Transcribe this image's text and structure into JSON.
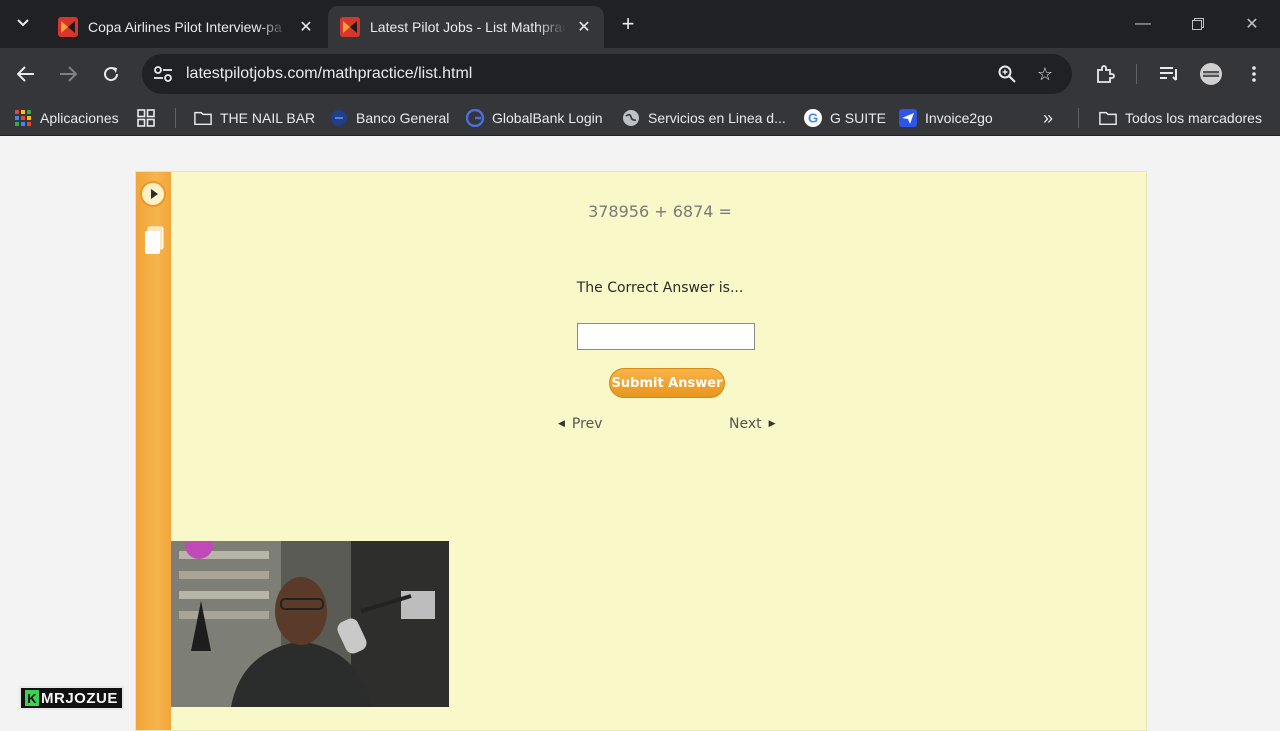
{
  "browser": {
    "tabs": [
      {
        "title": "Copa Airlines Pilot Interview-pa",
        "active": false
      },
      {
        "title": "Latest Pilot Jobs - List Mathprac",
        "active": true
      }
    ],
    "new_tab_label": "+",
    "url": "latestpilotjobs.com/mathpractice/list.html",
    "bookmarks": [
      {
        "label": "Aplicaciones",
        "icon": "apps-grid-icon"
      },
      {
        "label": "",
        "icon": "tab-groups-icon"
      },
      {
        "label": "THE NAIL BAR",
        "icon": "folder-icon"
      },
      {
        "label": "Banco General",
        "icon": "bank-icon"
      },
      {
        "label": "GlobalBank Login",
        "icon": "globalbank-icon"
      },
      {
        "label": "Servicios en Linea d...",
        "icon": "globe-icon"
      },
      {
        "label": "G SUITE",
        "icon": "google-icon"
      },
      {
        "label": "Invoice2go",
        "icon": "invoice2go-icon"
      }
    ],
    "overflow_label": "»",
    "all_bookmarks_label": "Todos los marcadores"
  },
  "quiz": {
    "equation": "378956 + 6874 =",
    "prompt": "The Correct Answer is...",
    "answer_value": "",
    "submit_label": "Submit Answer",
    "prev_label": "Prev",
    "next_label": "Next"
  },
  "overlay": {
    "streamer_tag": "MRJOZUE",
    "tag_letter": "K"
  },
  "colors": {
    "chrome_dark": "#202124",
    "chrome_toolbar": "#35363a",
    "page_bg": "#f8f8c8",
    "rail_orange": "#f2a53a",
    "button_orange": "#e8951f"
  }
}
